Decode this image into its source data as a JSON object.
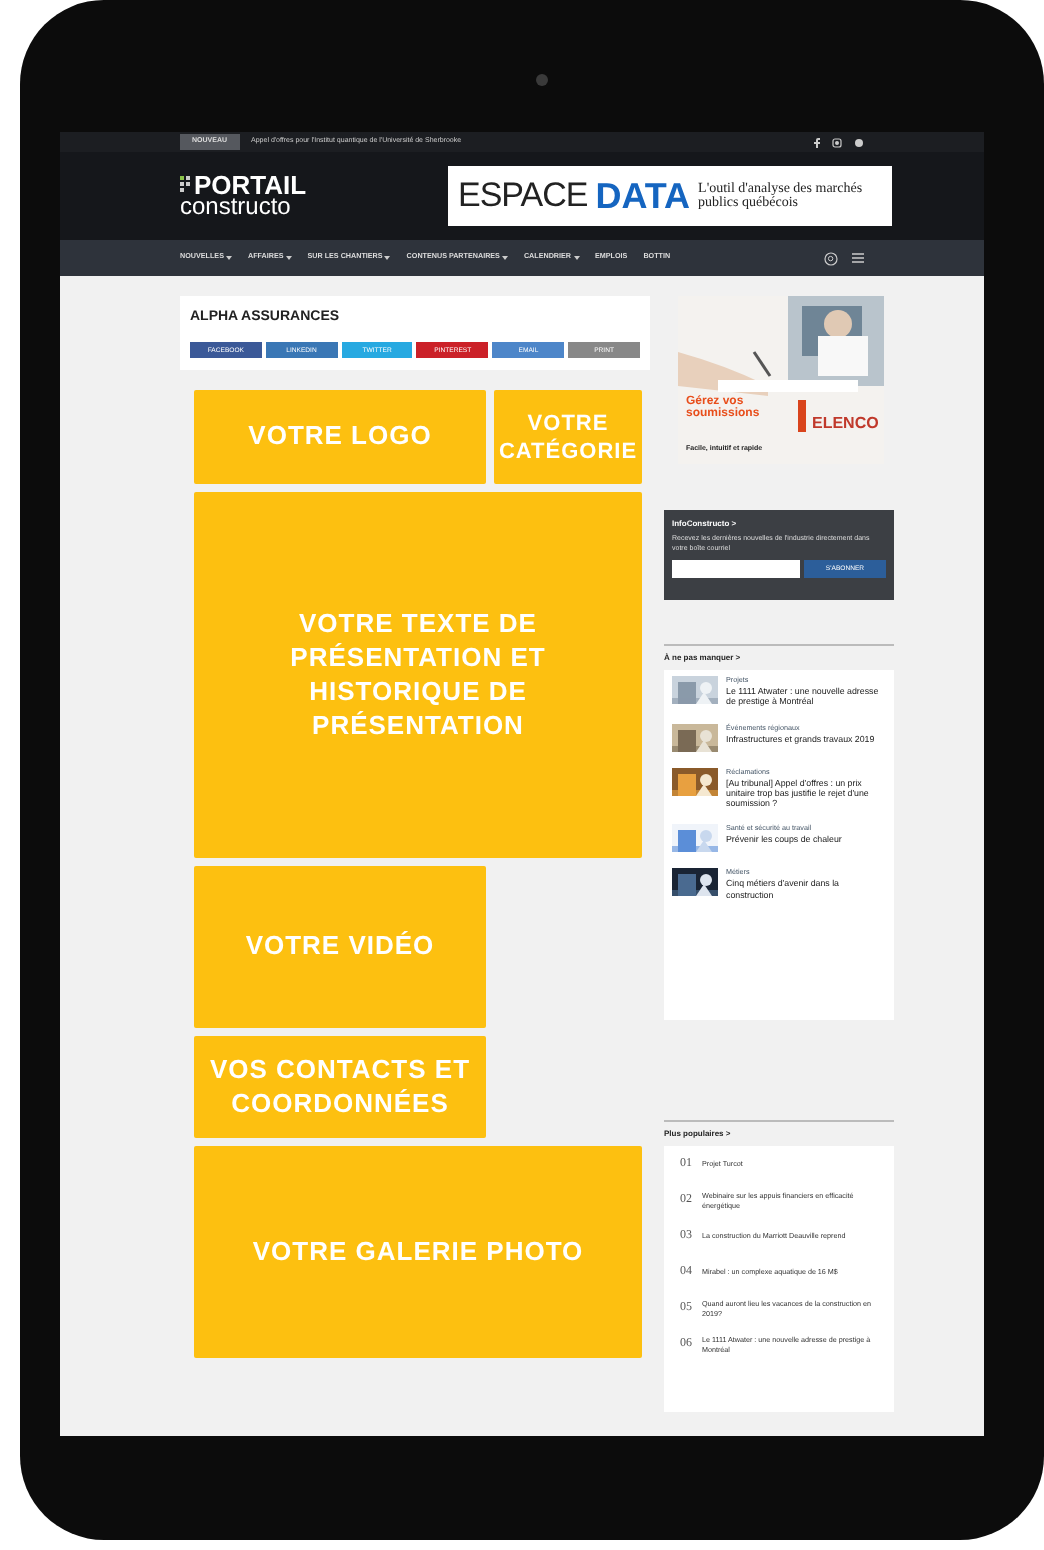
{
  "ticker": {
    "label": "NOUVEAU",
    "text": "Appel d'offres pour l'Institut quantique de l'Université de Sherbrooke"
  },
  "logo": {
    "line1": "PORTAIL",
    "line2": "constructo"
  },
  "banner": {
    "word1": "ESPACE",
    "word2": "DATA",
    "tagline": "L'outil d'analyse des marchés publics québécois"
  },
  "nav": [
    {
      "label": "NOUVELLES",
      "has_menu": true
    },
    {
      "label": "AFFAIRES",
      "has_menu": true
    },
    {
      "label": "SUR LES CHANTIERS",
      "has_menu": true
    },
    {
      "label": "CONTENUS PARTENAIRES",
      "has_menu": true
    },
    {
      "label": "CALENDRIER",
      "has_menu": true
    },
    {
      "label": "EMPLOIS",
      "has_menu": false
    },
    {
      "label": "BOTTIN",
      "has_menu": false
    }
  ],
  "company": {
    "name": "ALPHA ASSURANCES",
    "share": [
      {
        "label": "FACEBOOK",
        "color": "#3b5998"
      },
      {
        "label": "LINKEDIN",
        "color": "#3a77b5"
      },
      {
        "label": "TWITTER",
        "color": "#27a9e1"
      },
      {
        "label": "PINTEREST",
        "color": "#cb2128"
      },
      {
        "label": "EMAIL",
        "color": "#4d86c9"
      },
      {
        "label": "PRINT",
        "color": "#888888"
      }
    ]
  },
  "blocks": [
    [
      {
        "label": "VOTRE LOGO",
        "kind": "main"
      },
      {
        "label": "VOTRE CATÉGORIE",
        "kind": "side"
      }
    ],
    [
      {
        "label": "VOTRE TEXTE DE PRÉSENTATION ET HISTORIQUE DE PRÉSENTATION",
        "kind": "full"
      }
    ],
    [
      {
        "label": "VOTRE VIDÉO",
        "kind": "main"
      }
    ],
    [
      {
        "label": "VOS CONTACTS ET COORDONNÉES",
        "kind": "main"
      }
    ],
    [
      {
        "label": "VOTRE GALERIE PHOTO",
        "kind": "full"
      }
    ]
  ],
  "ad": {
    "headline": "Gérez vos soumissions",
    "brand": "ELENCO",
    "tagline": "Facile, intuitif et rapide"
  },
  "newsletter": {
    "title": "InfoConstructo >",
    "text": "Recevez les dernières nouvelles de l'industrie directement dans votre boîte courriel",
    "button": "S'ABONNER"
  },
  "featured": {
    "title": "À ne pas manquer >",
    "items": [
      {
        "category": "Projets",
        "title": "Le 1111 Atwater : une nouvelle adresse de prestige à Montréal"
      },
      {
        "category": "Événements régionaux",
        "title": "Infrastructures et grands travaux 2019"
      },
      {
        "category": "Réclamations",
        "title": "[Au tribunal] Appel d'offres : un prix unitaire trop bas justifie le rejet d'une soumission ?"
      },
      {
        "category": "Santé et sécurité au travail",
        "title": "Prévenir les coups de chaleur"
      },
      {
        "category": "Métiers",
        "title": "Cinq métiers d'avenir dans la construction"
      }
    ]
  },
  "popular": {
    "title": "Plus populaires >",
    "items": [
      {
        "rank": "01",
        "title": "Projet Turcot"
      },
      {
        "rank": "02",
        "title": "Webinaire sur les appuis financiers en efficacité énergétique"
      },
      {
        "rank": "03",
        "title": "La construction du Marriott Deauville reprend"
      },
      {
        "rank": "04",
        "title": "Mirabel : un complexe aquatique de 16 M$"
      },
      {
        "rank": "05",
        "title": "Quand auront lieu les vacances de la construction en 2019?"
      },
      {
        "rank": "06",
        "title": "Le 1111 Atwater : une nouvelle adresse de prestige à Montréal"
      }
    ]
  }
}
